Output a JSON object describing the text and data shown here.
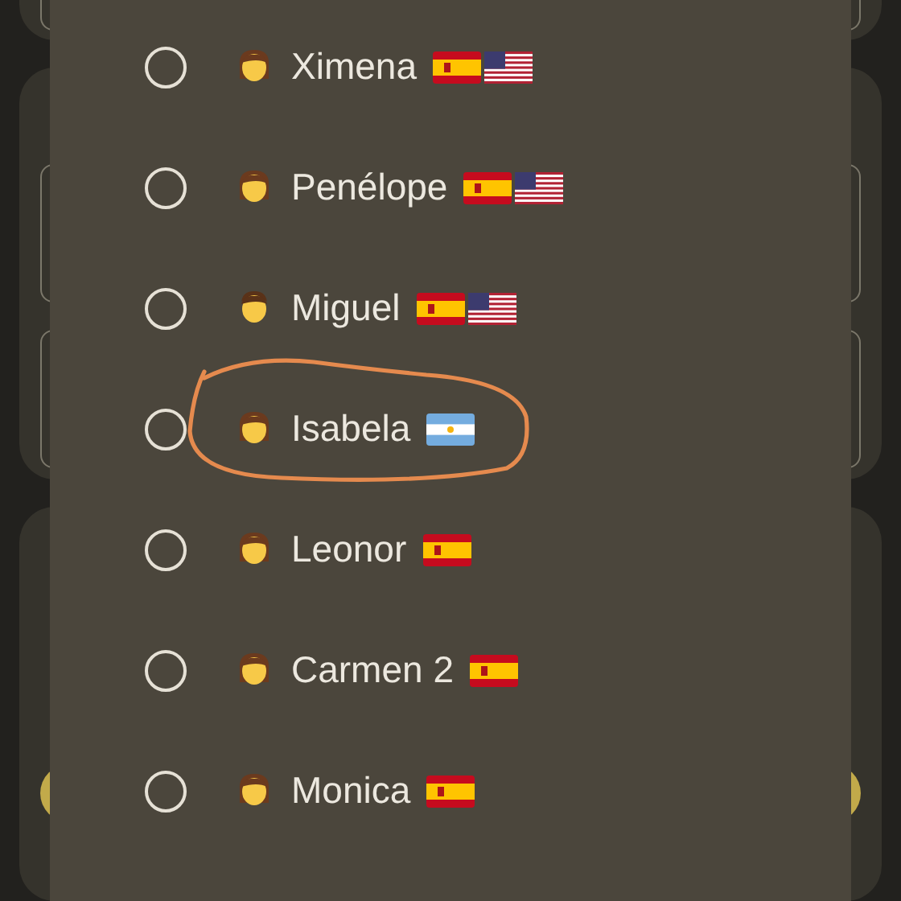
{
  "dialog": {
    "options": [
      {
        "name": "Ximena",
        "kind": "woman",
        "flags": [
          {
            "kind": "es"
          },
          {
            "kind": "us"
          }
        ],
        "selected": false,
        "circled": false
      },
      {
        "name": "Penélope",
        "kind": "woman",
        "flags": [
          {
            "kind": "es"
          },
          {
            "kind": "us"
          }
        ],
        "selected": false,
        "circled": false
      },
      {
        "name": "Miguel",
        "kind": "man",
        "flags": [
          {
            "kind": "es"
          },
          {
            "kind": "us"
          }
        ],
        "selected": false,
        "circled": false
      },
      {
        "name": "Isabela",
        "kind": "woman",
        "flags": [
          {
            "kind": "ar"
          }
        ],
        "selected": false,
        "circled": true
      },
      {
        "name": "Leonor",
        "kind": "woman",
        "flags": [
          {
            "kind": "es"
          }
        ],
        "selected": false,
        "circled": false
      },
      {
        "name": "Carmen 2",
        "kind": "woman",
        "flags": [
          {
            "kind": "es"
          }
        ],
        "selected": false,
        "circled": false
      },
      {
        "name": "Monica",
        "kind": "woman",
        "flags": [
          {
            "kind": "es"
          }
        ],
        "selected": false,
        "circled": false
      }
    ]
  }
}
